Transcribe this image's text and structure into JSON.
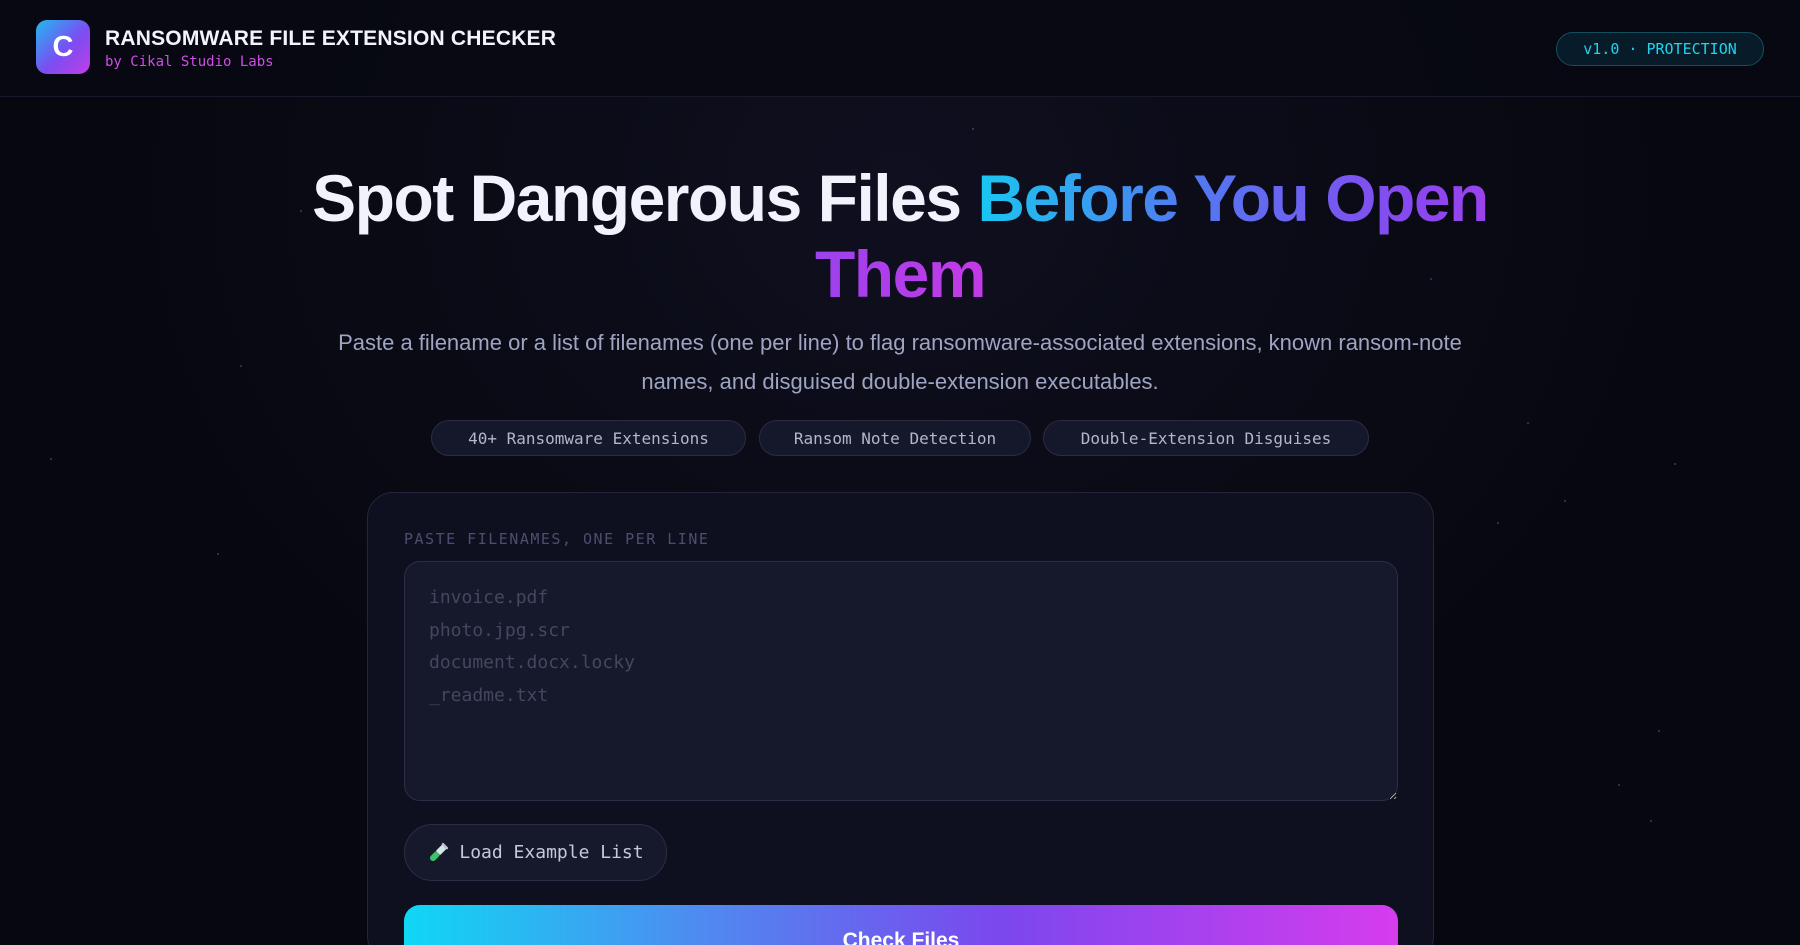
{
  "header": {
    "logo_letter": "C",
    "title": "RANSOMWARE FILE EXTENSION CHECKER",
    "subtitle": "by Cikal Studio Labs",
    "version_badge": "v1.0 · PROTECTION"
  },
  "hero": {
    "title_plain": "Spot Dangerous Files ",
    "title_gradient": "Before You Open Them",
    "description": "Paste a filename or a list of filenames (one per line) to flag ransomware-associated extensions, known ransom-note names, and disguised double-extension executables.",
    "pills": [
      "40+ Ransomware Extensions",
      "Ransom Note Detection",
      "Double-Extension Disguises"
    ]
  },
  "checker": {
    "field_label": "PASTE FILENAMES, ONE PER LINE",
    "placeholder": "invoice.pdf\nphoto.jpg.scr\ndocument.docx.locky\n_readme.txt",
    "value": "",
    "example_button_label": "Load Example List",
    "example_button_icon": "test-tube-icon",
    "check_button_label": "Check Files"
  },
  "colors": {
    "background": "#07080f",
    "accent_cyan": "#1ed4ef",
    "accent_purple": "#8b46ef",
    "accent_magenta": "#d24ce8"
  }
}
